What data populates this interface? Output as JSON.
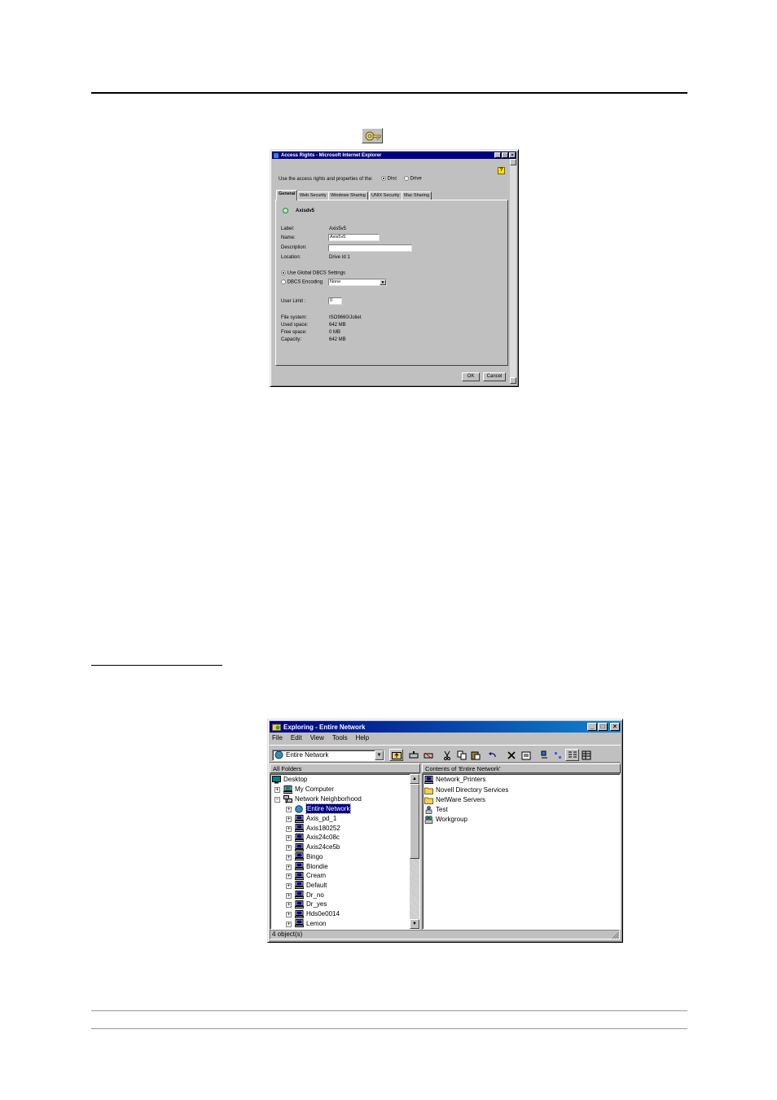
{
  "dialog": {
    "title": "Access Rights - Microsoft Internet Explorer",
    "use_rights_label": "Use the access rights and properties of the:",
    "radio_disc": "Disc",
    "radio_drive": "Drive",
    "tabs": [
      "General",
      "Web Security",
      "Windows Sharing",
      "UNIX Security",
      "Mac Sharing"
    ],
    "share_name": "Axisdv5",
    "fields": {
      "label_label": "Label:",
      "label_value": "Axis5v5",
      "name_label": "Name:",
      "name_value": "Axis5v5",
      "description_label": "Description:",
      "description_value": "",
      "location_label": "Location:",
      "location_value": "Drive Id 1"
    },
    "dbcs_global": "Use Global DBCS Settings",
    "dbcs_encoding_label": "DBCS Encoding",
    "dbcs_encoding_value": "None",
    "user_limit_label": "User Limit :",
    "user_limit_value": "0",
    "stats": {
      "fs_label": "File system:",
      "fs_value": "ISO9660/Joliet",
      "used_label": "Used space:",
      "used_value": "642 MB",
      "free_label": "Free space:",
      "free_value": "0 MB",
      "cap_label": "Capacity:",
      "cap_value": "642 MB"
    },
    "ok": "OK",
    "cancel": "Cancel"
  },
  "explorer": {
    "title": "Exploring - Entire Network",
    "menu": [
      "File",
      "Edit",
      "View",
      "Tools",
      "Help"
    ],
    "address": "Entire Network",
    "left_header": "All Folders",
    "right_header": "Contents of 'Entire Network'",
    "tree": {
      "desktop": "Desktop",
      "my_computer": "My Computer",
      "network_neighborhood": "Network Neighborhood",
      "entire_network": "Entire Network",
      "computers": [
        "Axis_pd_1",
        "Axis180252",
        "Axis24c08c",
        "Axis24ce5b",
        "Bingo",
        "Blondie",
        "Cream",
        "Default",
        "Dr_no",
        "Dr_yes",
        "Hds0e0014",
        "Lemon"
      ]
    },
    "contents": [
      "Network_Printers",
      "Novell Directory Services",
      "NetWare Servers",
      "Test",
      "Workgroup"
    ],
    "status": "4 object(s)"
  }
}
